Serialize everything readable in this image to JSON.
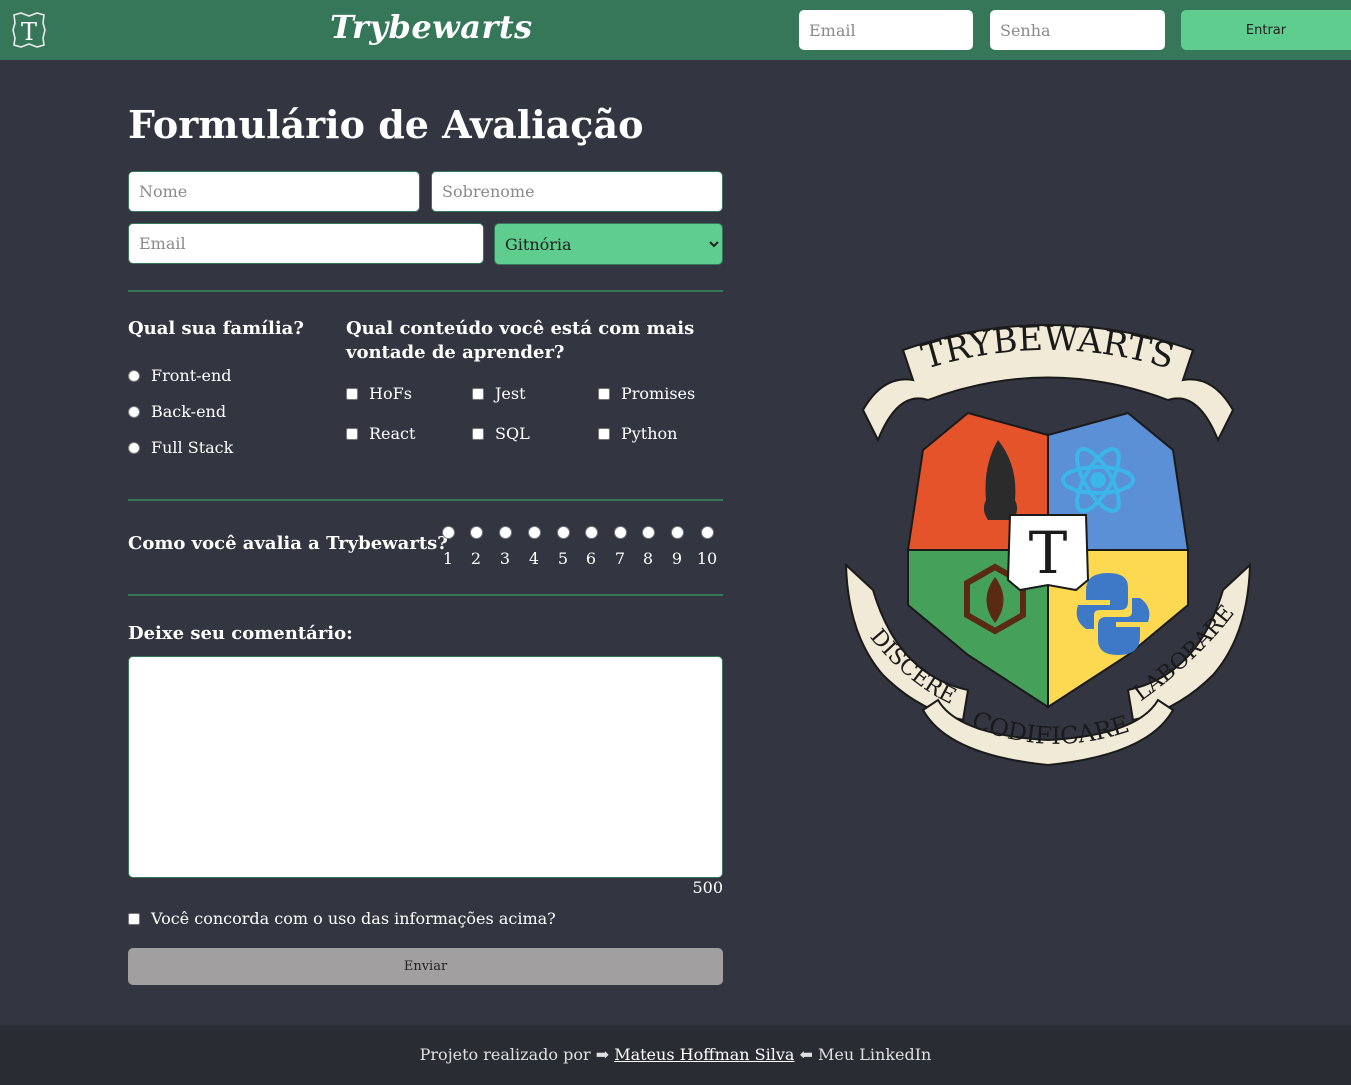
{
  "header": {
    "logo_letter": "T",
    "title": "Trybewarts",
    "email_placeholder": "Email",
    "password_placeholder": "Senha",
    "login_button": "Entrar"
  },
  "form": {
    "title": "Formulário de Avaliação",
    "name_placeholder": "Nome",
    "lastname_placeholder": "Sobrenome",
    "email_placeholder": "Email",
    "house_selected": "Gitnória",
    "family": {
      "question": "Qual sua família?",
      "options": [
        "Front-end",
        "Back-end",
        "Full Stack"
      ]
    },
    "content": {
      "question": "Qual conteúdo você está com mais vontade de aprender?",
      "options": [
        "HoFs",
        "Jest",
        "Promises",
        "React",
        "SQL",
        "Python"
      ]
    },
    "rating": {
      "question": "Como você avalia a Trybewarts?",
      "options": [
        "1",
        "2",
        "3",
        "4",
        "5",
        "6",
        "7",
        "8",
        "9",
        "10"
      ]
    },
    "comment": {
      "label": "Deixe seu comentário:",
      "counter": "500"
    },
    "agreement": "Você concorda com o uso das informações acima?",
    "submit": "Enviar"
  },
  "crest": {
    "banner_top": "TRYBEWARTS",
    "banner_left": "DISCERE",
    "banner_bottom": "CODIFICARE",
    "banner_right": "LABORARE",
    "center_letter": "T",
    "colors": {
      "red": "#e5532b",
      "blue": "#5b8fd6",
      "green": "#45a05a",
      "yellow": "#fcd950",
      "ribbon": "#f0ead6"
    }
  },
  "footer": {
    "prefix": "Projeto realizado por ➡",
    "author": "Mateus Hoffman Silva",
    "suffix": "⬅ Meu LinkedIn"
  },
  "colors": {
    "header": "#36775a",
    "accent": "#5ecd8d",
    "background": "#333640",
    "submit": "#a19f9f"
  }
}
